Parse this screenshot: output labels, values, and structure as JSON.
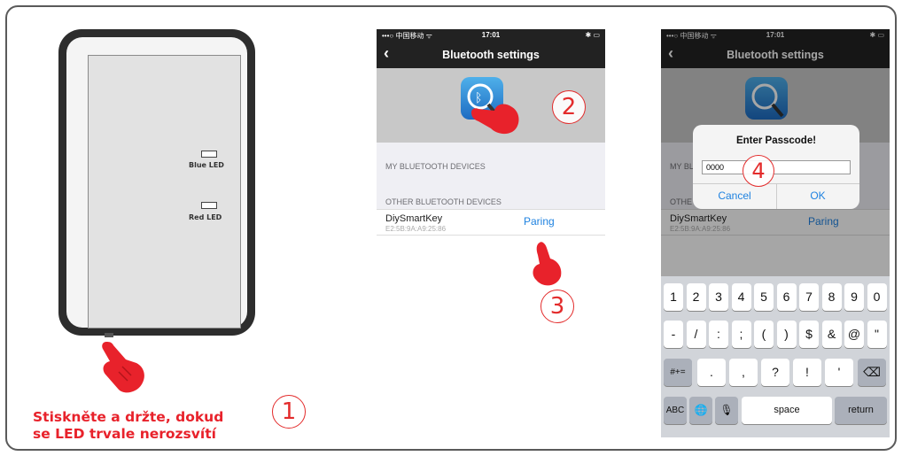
{
  "step1": {
    "led_blue": "Blue LED",
    "led_red": "Red LED",
    "instruction_line1": "Stiskněte a držte, dokud",
    "instruction_line2": "se LED trvale nerozsvítí",
    "number": "1"
  },
  "phone1": {
    "status": {
      "carrier": "•••○ 中国移动 ᯤ",
      "time": "17:01",
      "battery": "✱ ▭"
    },
    "nav_title": "Bluetooth settings",
    "section_my": "MY BLUETOOTH DEVICES",
    "section_other": "OTHER BLUETOOTH DEVICES",
    "device_name": "DiySmartKey",
    "device_mac": "E2:5B:9A:A9:25:86",
    "pair_label": "Paring",
    "step_a": "2",
    "step_b": "3"
  },
  "phone2": {
    "status": {
      "carrier": "•••○ 中国移动 ᯤ",
      "time": "17:01",
      "battery": "✱ ▭"
    },
    "nav_title": "Bluetooth settings",
    "section_my": "MY BL",
    "section_other": "OTHE",
    "device_name": "DiySmartKey",
    "device_mac": "E2:5B:9A:A9:25:86",
    "pair_label": "Paring",
    "dialog_title": "Enter Passcode!",
    "dialog_value": "0000",
    "cancel_label": "Cancel",
    "ok_label": "OK",
    "step": "4",
    "keys_row1": [
      "1",
      "2",
      "3",
      "4",
      "5",
      "6",
      "7",
      "8",
      "9",
      "0"
    ],
    "keys_row2": [
      "-",
      "/",
      ":",
      ";",
      "(",
      ")",
      "$",
      "&",
      "@",
      "\""
    ],
    "keys_row3": [
      ".",
      ",",
      "?",
      "!",
      "'"
    ],
    "key_symbols": "#+=",
    "key_backspace": "⌫",
    "key_abc": "ABC",
    "key_globe": "🌐",
    "key_mic": "🎙",
    "key_space": "space",
    "key_return": "return"
  },
  "colors": {
    "accent_red": "#e32c2c",
    "ios_blue": "#1f82e0"
  }
}
